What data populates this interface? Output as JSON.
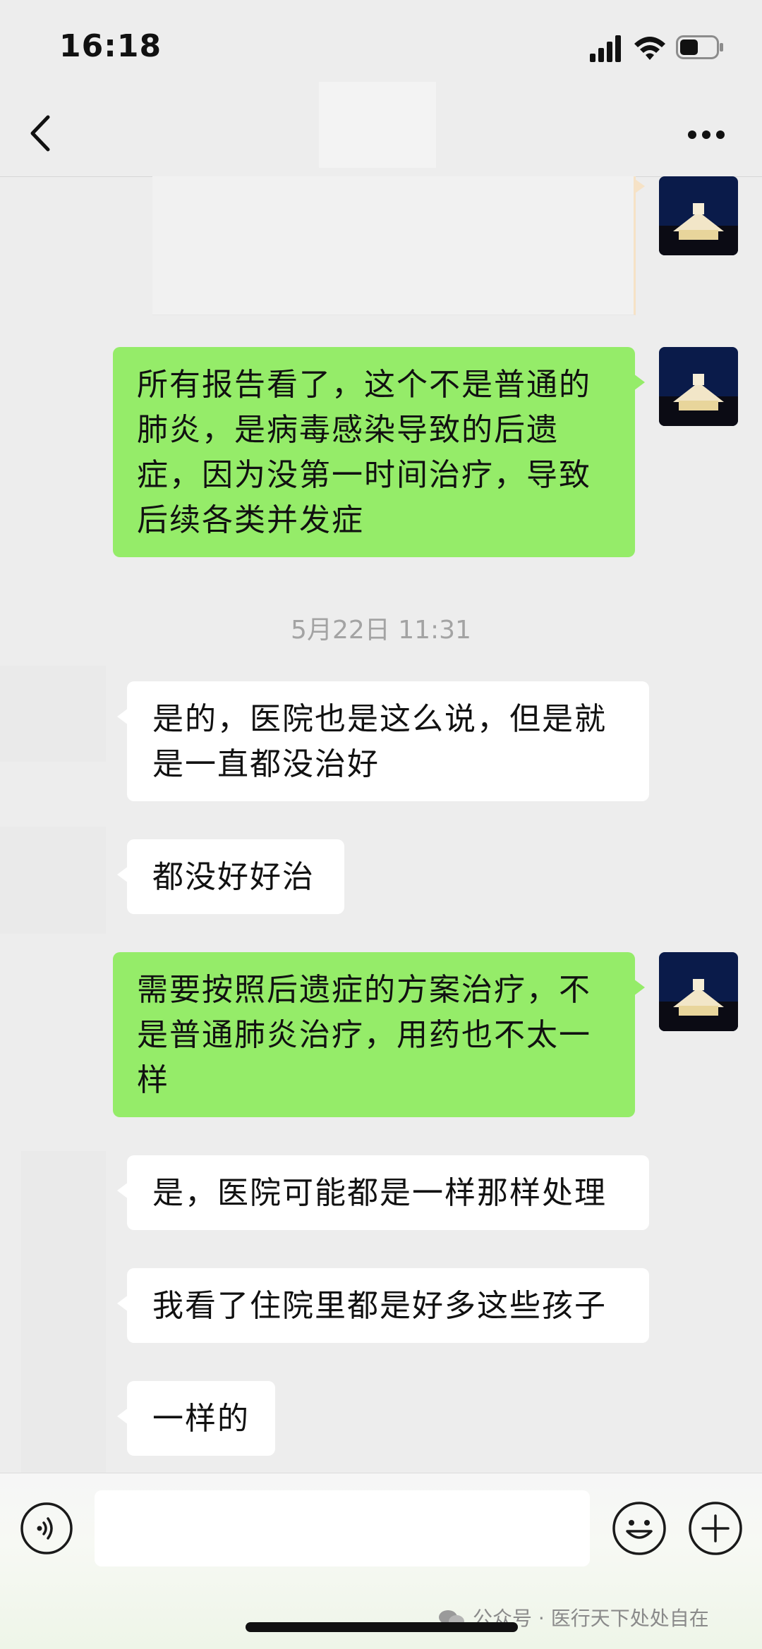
{
  "status_bar": {
    "time": "16:18",
    "battery_level": 0.5
  },
  "nav": {
    "title": "",
    "back_icon": "chevron-left-icon",
    "more_icon": "ellipsis-icon"
  },
  "messages": [
    {
      "side": "me",
      "text": "所有报告看了，这个不是普通的肺炎，是病毒感染导致的后遗症，因为没第一时间治疗，导致后续各类并发症"
    },
    {
      "timestamp": "5月22日 11:31"
    },
    {
      "side": "them",
      "text": "是的，医院也是这么说，但是就是一直都没治好"
    },
    {
      "side": "them",
      "text": "都没好好治"
    },
    {
      "side": "me",
      "text": "需要按照后遗症的方案治疗，不是普通肺炎治疗，用药也不太一样"
    },
    {
      "side": "them",
      "text": "是，医院可能都是一样那样处理"
    },
    {
      "side": "them",
      "text": "我看了住院里都是好多这些孩子"
    },
    {
      "side": "them",
      "text": "一样的"
    }
  ],
  "input_bar": {
    "placeholder": "",
    "voice_icon": "voice-icon",
    "emoji_icon": "emoji-icon",
    "plus_icon": "plus-circle-icon"
  },
  "watermark": "公众号 · 医行天下处处自在",
  "colors": {
    "background": "#ededed",
    "my_bubble": "#95ec69",
    "their_bubble": "#ffffff",
    "timestamp_text": "#a3a3a3"
  }
}
